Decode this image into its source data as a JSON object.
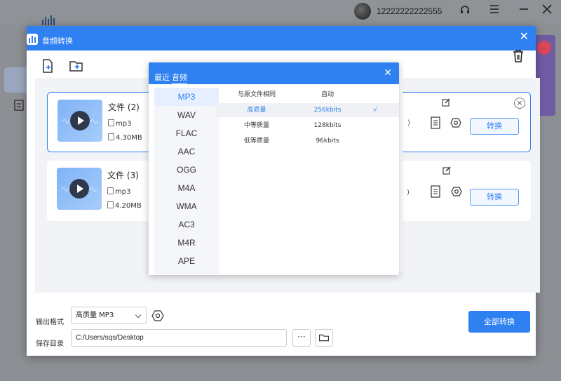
{
  "background": {
    "user": "12222222222555",
    "controls": [
      "headset-icon",
      "menu-icon",
      "minimize-icon",
      "close-icon"
    ]
  },
  "dialog": {
    "title": "音频转换",
    "close_glyph": "✕"
  },
  "files": [
    {
      "name": "文件 (2)",
      "format": "mp3",
      "size": "4.30MB",
      "convert_label": "转换",
      "selected": true
    },
    {
      "name": "文件 (3)",
      "format": "mp3",
      "size": "4.20MB",
      "convert_label": "转换",
      "selected": false
    }
  ],
  "format_popup": {
    "tabs": [
      {
        "label": "最近",
        "active": false
      },
      {
        "label": "音频",
        "active": true
      }
    ],
    "close_glyph": "✕",
    "formats": [
      "MP3",
      "WAV",
      "FLAC",
      "AAC",
      "OGG",
      "M4A",
      "WMA",
      "AC3",
      "M4R",
      "APE"
    ],
    "active_format": "MP3",
    "qualities": [
      {
        "name": "与原文件相同",
        "rate": "自动",
        "check": ""
      },
      {
        "name": "高质量",
        "rate": "256kbits",
        "check": "√"
      },
      {
        "name": "中等质量",
        "rate": "128kbits",
        "check": ""
      },
      {
        "name": "低等质量",
        "rate": "96kbits",
        "check": ""
      }
    ]
  },
  "bottom": {
    "output_label": "输出格式",
    "output_value": "高质量 MP3",
    "save_label": "保存目录",
    "save_path": "C:/Users/sqs/Desktop",
    "dots": "···",
    "convert_all": "全部转换"
  },
  "colors": {
    "accent": "#2f80f1",
    "overlay": "#8c8f93"
  }
}
